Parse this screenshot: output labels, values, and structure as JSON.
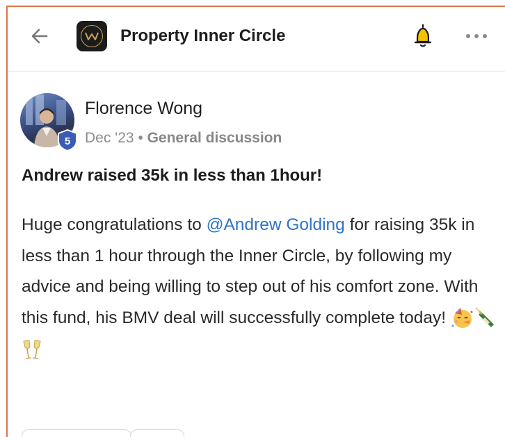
{
  "header": {
    "title": "Property Inner Circle",
    "logo_icon": "pic-logo-icon",
    "back_icon": "arrow-left-icon",
    "bell_icon": "bell-icon",
    "more_icon": "more-dots-icon"
  },
  "post": {
    "author": "Florence Wong",
    "level_badge": "5",
    "date": "Dec '23",
    "separator": "•",
    "category": "General discussion",
    "title": "Andrew raised 35k in less than 1hour!",
    "body_before": "Huge congratulations to ",
    "mention": "@Andrew Golding",
    "body_after": " for raising 35k in less than 1 hour through the Inner Circle, by following my advice and being willing to step out of his comfort zone. With this fund, his BMV deal will successfully complete today! ",
    "emojis": [
      "partying-face-icon",
      "champagne-bottle-icon",
      "clinking-glasses-icon"
    ]
  },
  "colors": {
    "frame_border": "#d9774b",
    "mention": "#2d73c9",
    "badge": "#3b5bb5",
    "bell": "#f2c200"
  }
}
